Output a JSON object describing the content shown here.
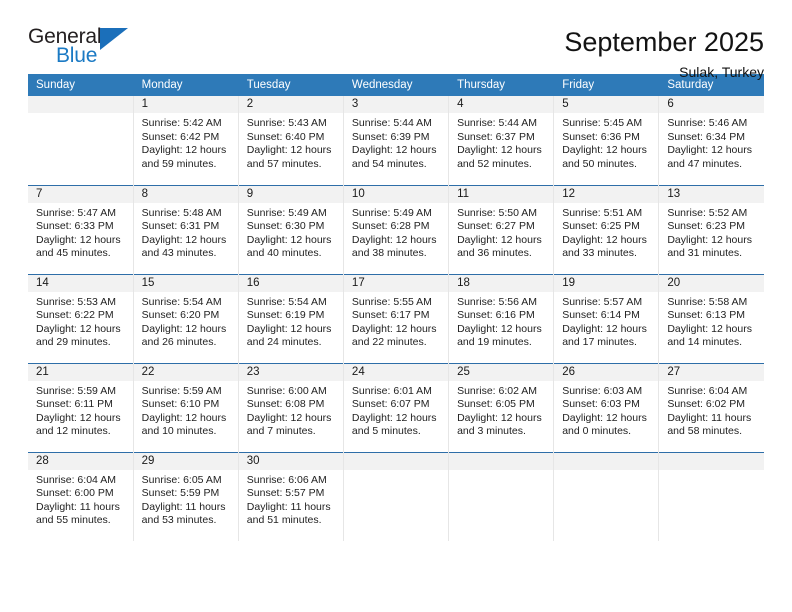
{
  "logo": {
    "top_text": "General",
    "bottom_text": "Blue",
    "triangle_icon": "triangle-icon",
    "blue": "#1b7ac4",
    "dark": "#231f20"
  },
  "header": {
    "month_title": "September 2025",
    "location": "Sulak, Turkey"
  },
  "theme": {
    "header_bg": "#2e7ab8",
    "header_text": "#ffffff",
    "daynum_bg": "#f2f2f2",
    "row_divider": "#2e6ea8",
    "cell_divider": "#e6e6e6"
  },
  "weekdays": [
    "Sunday",
    "Monday",
    "Tuesday",
    "Wednesday",
    "Thursday",
    "Friday",
    "Saturday"
  ],
  "weeks": [
    [
      {
        "day": "",
        "blank": true,
        "sunrise": "",
        "sunset": "",
        "daylight_line1": "",
        "daylight_line2": ""
      },
      {
        "day": "1",
        "sunrise": "Sunrise: 5:42 AM",
        "sunset": "Sunset: 6:42 PM",
        "daylight_line1": "Daylight: 12 hours",
        "daylight_line2": "and 59 minutes."
      },
      {
        "day": "2",
        "sunrise": "Sunrise: 5:43 AM",
        "sunset": "Sunset: 6:40 PM",
        "daylight_line1": "Daylight: 12 hours",
        "daylight_line2": "and 57 minutes."
      },
      {
        "day": "3",
        "sunrise": "Sunrise: 5:44 AM",
        "sunset": "Sunset: 6:39 PM",
        "daylight_line1": "Daylight: 12 hours",
        "daylight_line2": "and 54 minutes."
      },
      {
        "day": "4",
        "sunrise": "Sunrise: 5:44 AM",
        "sunset": "Sunset: 6:37 PM",
        "daylight_line1": "Daylight: 12 hours",
        "daylight_line2": "and 52 minutes."
      },
      {
        "day": "5",
        "sunrise": "Sunrise: 5:45 AM",
        "sunset": "Sunset: 6:36 PM",
        "daylight_line1": "Daylight: 12 hours",
        "daylight_line2": "and 50 minutes."
      },
      {
        "day": "6",
        "sunrise": "Sunrise: 5:46 AM",
        "sunset": "Sunset: 6:34 PM",
        "daylight_line1": "Daylight: 12 hours",
        "daylight_line2": "and 47 minutes."
      }
    ],
    [
      {
        "day": "7",
        "sunrise": "Sunrise: 5:47 AM",
        "sunset": "Sunset: 6:33 PM",
        "daylight_line1": "Daylight: 12 hours",
        "daylight_line2": "and 45 minutes."
      },
      {
        "day": "8",
        "sunrise": "Sunrise: 5:48 AM",
        "sunset": "Sunset: 6:31 PM",
        "daylight_line1": "Daylight: 12 hours",
        "daylight_line2": "and 43 minutes."
      },
      {
        "day": "9",
        "sunrise": "Sunrise: 5:49 AM",
        "sunset": "Sunset: 6:30 PM",
        "daylight_line1": "Daylight: 12 hours",
        "daylight_line2": "and 40 minutes."
      },
      {
        "day": "10",
        "sunrise": "Sunrise: 5:49 AM",
        "sunset": "Sunset: 6:28 PM",
        "daylight_line1": "Daylight: 12 hours",
        "daylight_line2": "and 38 minutes."
      },
      {
        "day": "11",
        "sunrise": "Sunrise: 5:50 AM",
        "sunset": "Sunset: 6:27 PM",
        "daylight_line1": "Daylight: 12 hours",
        "daylight_line2": "and 36 minutes."
      },
      {
        "day": "12",
        "sunrise": "Sunrise: 5:51 AM",
        "sunset": "Sunset: 6:25 PM",
        "daylight_line1": "Daylight: 12 hours",
        "daylight_line2": "and 33 minutes."
      },
      {
        "day": "13",
        "sunrise": "Sunrise: 5:52 AM",
        "sunset": "Sunset: 6:23 PM",
        "daylight_line1": "Daylight: 12 hours",
        "daylight_line2": "and 31 minutes."
      }
    ],
    [
      {
        "day": "14",
        "sunrise": "Sunrise: 5:53 AM",
        "sunset": "Sunset: 6:22 PM",
        "daylight_line1": "Daylight: 12 hours",
        "daylight_line2": "and 29 minutes."
      },
      {
        "day": "15",
        "sunrise": "Sunrise: 5:54 AM",
        "sunset": "Sunset: 6:20 PM",
        "daylight_line1": "Daylight: 12 hours",
        "daylight_line2": "and 26 minutes."
      },
      {
        "day": "16",
        "sunrise": "Sunrise: 5:54 AM",
        "sunset": "Sunset: 6:19 PM",
        "daylight_line1": "Daylight: 12 hours",
        "daylight_line2": "and 24 minutes."
      },
      {
        "day": "17",
        "sunrise": "Sunrise: 5:55 AM",
        "sunset": "Sunset: 6:17 PM",
        "daylight_line1": "Daylight: 12 hours",
        "daylight_line2": "and 22 minutes."
      },
      {
        "day": "18",
        "sunrise": "Sunrise: 5:56 AM",
        "sunset": "Sunset: 6:16 PM",
        "daylight_line1": "Daylight: 12 hours",
        "daylight_line2": "and 19 minutes."
      },
      {
        "day": "19",
        "sunrise": "Sunrise: 5:57 AM",
        "sunset": "Sunset: 6:14 PM",
        "daylight_line1": "Daylight: 12 hours",
        "daylight_line2": "and 17 minutes."
      },
      {
        "day": "20",
        "sunrise": "Sunrise: 5:58 AM",
        "sunset": "Sunset: 6:13 PM",
        "daylight_line1": "Daylight: 12 hours",
        "daylight_line2": "and 14 minutes."
      }
    ],
    [
      {
        "day": "21",
        "sunrise": "Sunrise: 5:59 AM",
        "sunset": "Sunset: 6:11 PM",
        "daylight_line1": "Daylight: 12 hours",
        "daylight_line2": "and 12 minutes."
      },
      {
        "day": "22",
        "sunrise": "Sunrise: 5:59 AM",
        "sunset": "Sunset: 6:10 PM",
        "daylight_line1": "Daylight: 12 hours",
        "daylight_line2": "and 10 minutes."
      },
      {
        "day": "23",
        "sunrise": "Sunrise: 6:00 AM",
        "sunset": "Sunset: 6:08 PM",
        "daylight_line1": "Daylight: 12 hours",
        "daylight_line2": "and 7 minutes."
      },
      {
        "day": "24",
        "sunrise": "Sunrise: 6:01 AM",
        "sunset": "Sunset: 6:07 PM",
        "daylight_line1": "Daylight: 12 hours",
        "daylight_line2": "and 5 minutes."
      },
      {
        "day": "25",
        "sunrise": "Sunrise: 6:02 AM",
        "sunset": "Sunset: 6:05 PM",
        "daylight_line1": "Daylight: 12 hours",
        "daylight_line2": "and 3 minutes."
      },
      {
        "day": "26",
        "sunrise": "Sunrise: 6:03 AM",
        "sunset": "Sunset: 6:03 PM",
        "daylight_line1": "Daylight: 12 hours",
        "daylight_line2": "and 0 minutes."
      },
      {
        "day": "27",
        "sunrise": "Sunrise: 6:04 AM",
        "sunset": "Sunset: 6:02 PM",
        "daylight_line1": "Daylight: 11 hours",
        "daylight_line2": "and 58 minutes."
      }
    ],
    [
      {
        "day": "28",
        "sunrise": "Sunrise: 6:04 AM",
        "sunset": "Sunset: 6:00 PM",
        "daylight_line1": "Daylight: 11 hours",
        "daylight_line2": "and 55 minutes."
      },
      {
        "day": "29",
        "sunrise": "Sunrise: 6:05 AM",
        "sunset": "Sunset: 5:59 PM",
        "daylight_line1": "Daylight: 11 hours",
        "daylight_line2": "and 53 minutes."
      },
      {
        "day": "30",
        "sunrise": "Sunrise: 6:06 AM",
        "sunset": "Sunset: 5:57 PM",
        "daylight_line1": "Daylight: 11 hours",
        "daylight_line2": "and 51 minutes."
      },
      {
        "day": "",
        "blank": true,
        "sunrise": "",
        "sunset": "",
        "daylight_line1": "",
        "daylight_line2": ""
      },
      {
        "day": "",
        "blank": true,
        "sunrise": "",
        "sunset": "",
        "daylight_line1": "",
        "daylight_line2": ""
      },
      {
        "day": "",
        "blank": true,
        "sunrise": "",
        "sunset": "",
        "daylight_line1": "",
        "daylight_line2": ""
      },
      {
        "day": "",
        "blank": true,
        "sunrise": "",
        "sunset": "",
        "daylight_line1": "",
        "daylight_line2": ""
      }
    ]
  ]
}
